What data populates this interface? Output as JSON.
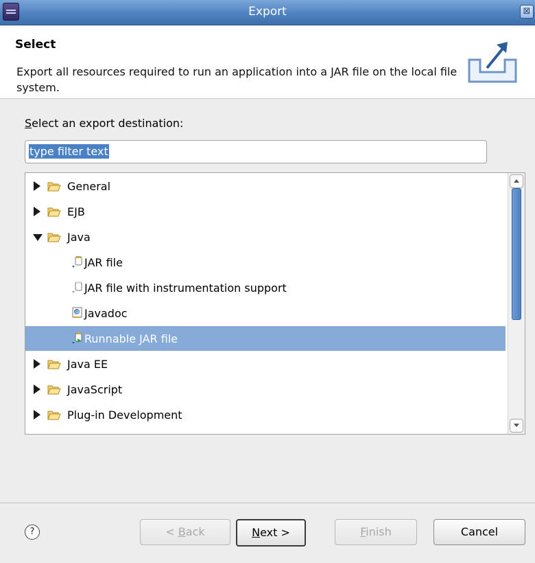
{
  "window": {
    "title": "Export",
    "close_glyph": "⊠"
  },
  "header": {
    "title": "Select",
    "description": "Export all resources required to run an application into a JAR file on the local file system.",
    "icon": "export-icon"
  },
  "main": {
    "destination_label_prefix": "",
    "destination_label_accel": "S",
    "destination_label_rest": "elect an export destination:",
    "filter": {
      "value": "type filter text"
    },
    "tree": [
      {
        "label": "General",
        "type": "folder",
        "expanded": false,
        "depth": 0
      },
      {
        "label": "EJB",
        "type": "folder",
        "expanded": false,
        "depth": 0
      },
      {
        "label": "Java",
        "type": "folder",
        "expanded": true,
        "depth": 0
      },
      {
        "label": "JAR file",
        "type": "jar",
        "depth": 1
      },
      {
        "label": "JAR file with instrumentation support",
        "type": "jar",
        "depth": 1
      },
      {
        "label": "Javadoc",
        "type": "javadoc",
        "depth": 1
      },
      {
        "label": "Runnable JAR file",
        "type": "jar-runnable",
        "depth": 1,
        "selected": true
      },
      {
        "label": "Java EE",
        "type": "folder",
        "expanded": false,
        "depth": 0
      },
      {
        "label": "JavaScript",
        "type": "folder",
        "expanded": false,
        "depth": 0
      },
      {
        "label": "Plug-in Development",
        "type": "folder",
        "expanded": false,
        "depth": 0
      }
    ]
  },
  "footer": {
    "help_glyph": "?",
    "back_label": "< ",
    "back_accel": "B",
    "back_rest": "ack",
    "next_accel": "N",
    "next_rest": "ext >",
    "finish_accel": "F",
    "finish_rest": "inish",
    "cancel_label": "Cancel"
  },
  "colors": {
    "title_bar": "#4f82c0",
    "selection": "#86abd9",
    "filter_highlight": "#4a81c4",
    "scroll_thumb": "#4d80c2"
  }
}
